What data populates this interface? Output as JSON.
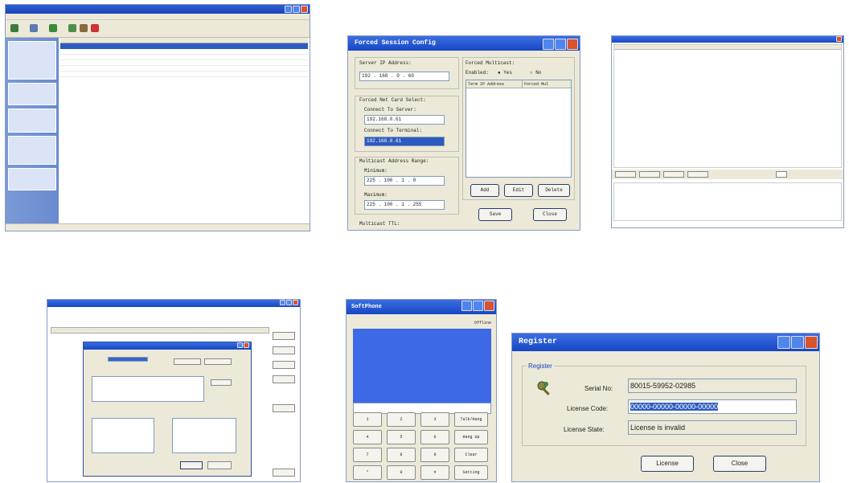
{
  "register": {
    "title": "Register",
    "group": "Register",
    "serial_label": "Serial No:",
    "serial_value": "80015-59952-02985",
    "license_code_label": "License Code:",
    "license_code_value": "00000-00000-00000-00000",
    "license_state_label": "License State:",
    "license_state_value": "License is invalid",
    "license_button": "License",
    "close_button": "Close"
  },
  "forced_session": {
    "title": "Forced Session Config",
    "server_ip_label": "Server IP Address:",
    "server_ip_value": "192 . 168 . 0 . 60",
    "nic_group": "Forced Net Card Select:",
    "connect_server_label": "Connect To Server:",
    "connect_server_value": "192.168.0.61",
    "connect_terminal_label": "Connect To Terminal:",
    "connect_terminal_value": "192.168.0.61",
    "range_group": "Multicast Address Range:",
    "minimum_label": "Minimum:",
    "minimum_value": "225 . 100 . 1 . 0",
    "maximum_label": "Maximum:",
    "maximum_value": "225 . 100 . 1 . 255",
    "ttl_label": "Multicast TTL:",
    "forced_multicast_label": "Forced Multicast:",
    "enabled_label": "Enabled:",
    "yes_label": "Yes",
    "no_label": "No",
    "col_ip": "Term IP Address",
    "col_mask": "Forced Mul",
    "add_button": "Add",
    "edit_button": "Edit",
    "delete_button": "Delete",
    "save_button": "Save",
    "close_button": "Close"
  },
  "softphone": {
    "title": "SoftPhone",
    "status": "Offline",
    "keys": [
      "1",
      "2",
      "3",
      "Talk/Hang",
      "4",
      "5",
      "6",
      "Hang Up",
      "7",
      "8",
      "9",
      "Clear",
      "*",
      "0",
      "#",
      "Setting"
    ]
  }
}
